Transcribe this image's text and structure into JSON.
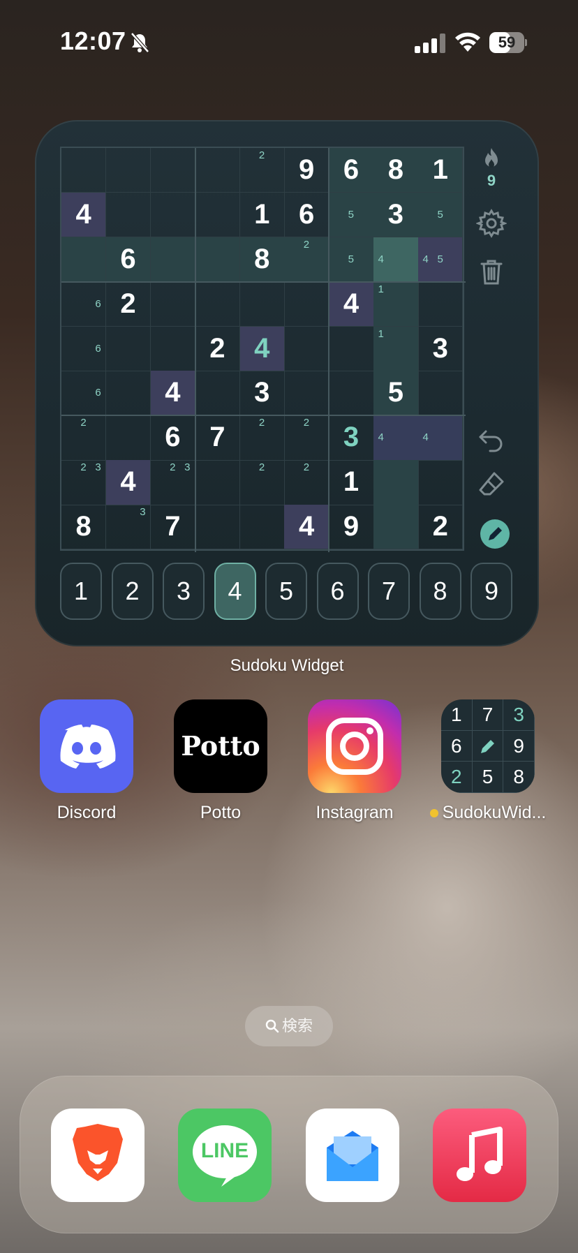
{
  "status_bar": {
    "time": "12:07",
    "battery_level": "59"
  },
  "widget": {
    "label": "Sudoku Widget",
    "streak": "9",
    "selected_number": "4",
    "number_pad": [
      "1",
      "2",
      "3",
      "4",
      "5",
      "6",
      "7",
      "8",
      "9"
    ],
    "cells": [
      {
        "r": 0,
        "c": 5,
        "v": "9"
      },
      {
        "r": 0,
        "c": 6,
        "v": "6"
      },
      {
        "r": 0,
        "c": 7,
        "v": "8"
      },
      {
        "r": 0,
        "c": 8,
        "v": "1"
      },
      {
        "r": 1,
        "c": 0,
        "v": "4"
      },
      {
        "r": 1,
        "c": 4,
        "v": "1"
      },
      {
        "r": 1,
        "c": 5,
        "v": "6"
      },
      {
        "r": 1,
        "c": 7,
        "v": "3"
      },
      {
        "r": 2,
        "c": 1,
        "v": "6"
      },
      {
        "r": 2,
        "c": 4,
        "v": "8"
      },
      {
        "r": 3,
        "c": 1,
        "v": "2"
      },
      {
        "r": 3,
        "c": 6,
        "v": "4"
      },
      {
        "r": 4,
        "c": 3,
        "v": "2"
      },
      {
        "r": 4,
        "c": 4,
        "v": "4",
        "entered": true
      },
      {
        "r": 4,
        "c": 8,
        "v": "3"
      },
      {
        "r": 5,
        "c": 2,
        "v": "4"
      },
      {
        "r": 5,
        "c": 4,
        "v": "3"
      },
      {
        "r": 5,
        "c": 7,
        "v": "5"
      },
      {
        "r": 6,
        "c": 2,
        "v": "6"
      },
      {
        "r": 6,
        "c": 3,
        "v": "7"
      },
      {
        "r": 6,
        "c": 6,
        "v": "3",
        "entered": true
      },
      {
        "r": 7,
        "c": 1,
        "v": "4"
      },
      {
        "r": 7,
        "c": 6,
        "v": "1"
      },
      {
        "r": 8,
        "c": 0,
        "v": "8"
      },
      {
        "r": 8,
        "c": 2,
        "v": "7"
      },
      {
        "r": 8,
        "c": 5,
        "v": "4"
      },
      {
        "r": 8,
        "c": 6,
        "v": "9"
      },
      {
        "r": 8,
        "c": 8,
        "v": "2"
      }
    ],
    "notes": [
      {
        "r": 0,
        "c": 4,
        "n": [
          "2"
        ]
      },
      {
        "r": 1,
        "c": 6,
        "n": [
          "5"
        ]
      },
      {
        "r": 1,
        "c": 8,
        "n": [
          "5"
        ]
      },
      {
        "r": 2,
        "c": 5,
        "n": [
          "2"
        ]
      },
      {
        "r": 2,
        "c": 6,
        "n": [
          "5"
        ]
      },
      {
        "r": 2,
        "c": 7,
        "n": [
          "4"
        ]
      },
      {
        "r": 2,
        "c": 8,
        "n": [
          "4",
          "5"
        ]
      },
      {
        "r": 3,
        "c": 0,
        "n": [
          "6"
        ]
      },
      {
        "r": 3,
        "c": 7,
        "n": [
          "1"
        ]
      },
      {
        "r": 4,
        "c": 0,
        "n": [
          "6"
        ]
      },
      {
        "r": 4,
        "c": 7,
        "n": [
          "1"
        ]
      },
      {
        "r": 5,
        "c": 0,
        "n": [
          "6"
        ]
      },
      {
        "r": 6,
        "c": 0,
        "n": [
          "2"
        ]
      },
      {
        "r": 6,
        "c": 4,
        "n": [
          "2"
        ]
      },
      {
        "r": 6,
        "c": 5,
        "n": [
          "2"
        ]
      },
      {
        "r": 6,
        "c": 7,
        "n": [
          "4"
        ]
      },
      {
        "r": 6,
        "c": 8,
        "n": [
          "4"
        ]
      },
      {
        "r": 7,
        "c": 0,
        "n": [
          "2",
          "3"
        ]
      },
      {
        "r": 7,
        "c": 2,
        "n": [
          "2",
          "3"
        ]
      },
      {
        "r": 7,
        "c": 4,
        "n": [
          "2"
        ]
      },
      {
        "r": 7,
        "c": 5,
        "n": [
          "2"
        ]
      },
      {
        "r": 8,
        "c": 1,
        "n": [
          "3"
        ]
      }
    ]
  },
  "apps": [
    {
      "label": "Discord"
    },
    {
      "label": "Potto",
      "icon_text": "Potto"
    },
    {
      "label": "Instagram"
    },
    {
      "label": "SudokuWid..."
    }
  ],
  "sudoku_icon_digits": [
    "1",
    "7",
    "3",
    "6",
    "",
    "9",
    "2",
    "5",
    "8"
  ],
  "search": {
    "label": "検索"
  },
  "dock": {
    "line_text": "LINE"
  },
  "colors": {
    "accent": "#5fb5a6",
    "highlight_row": "#2c4a4b",
    "highlight_same": "#3e3e5e",
    "discord": "#5865f2",
    "line": "#4cc764"
  }
}
